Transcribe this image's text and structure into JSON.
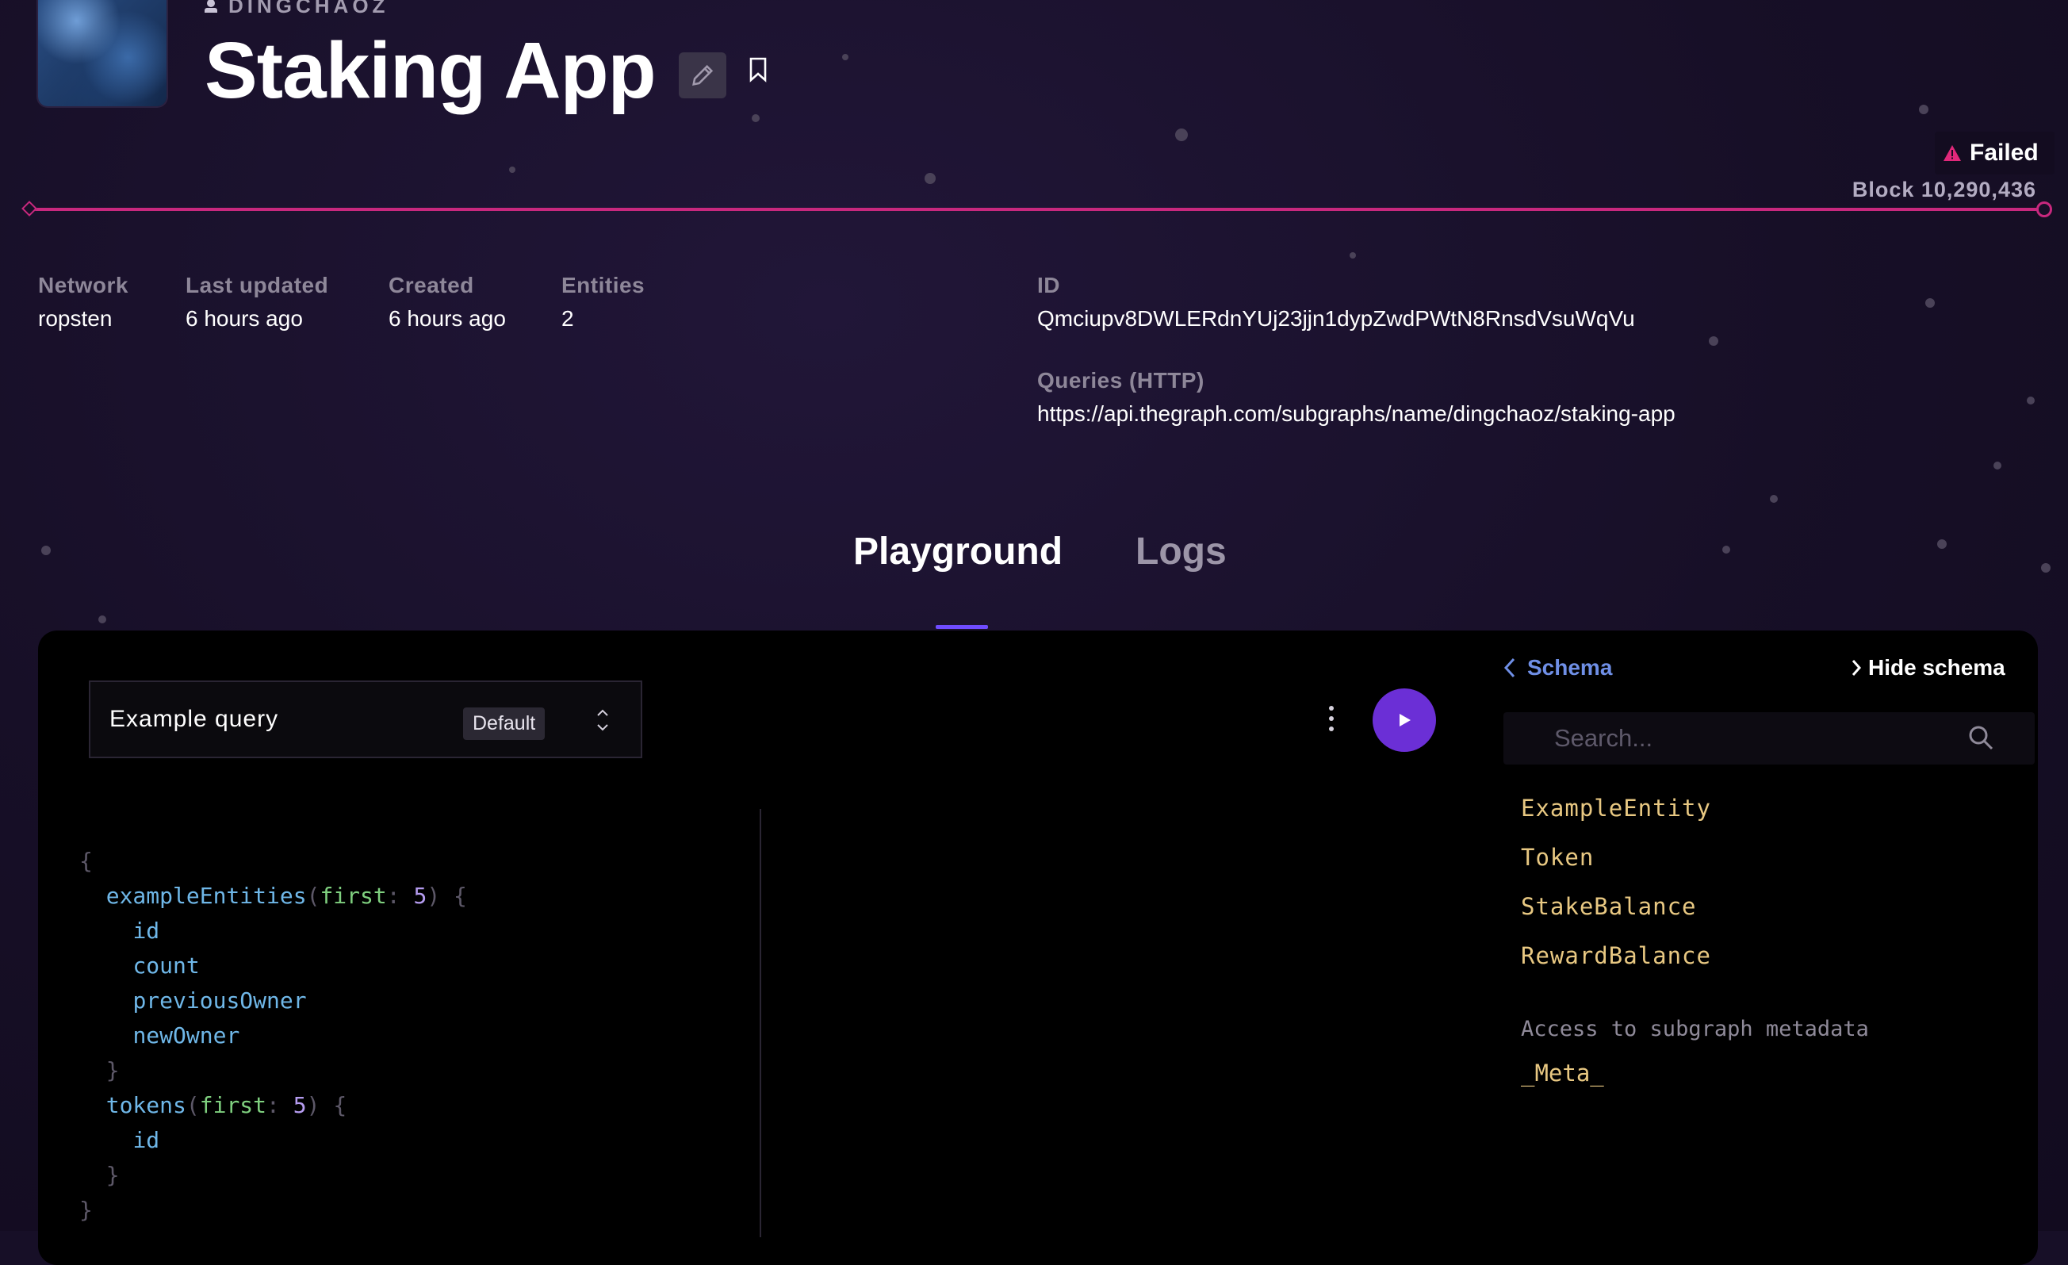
{
  "header": {
    "owner": "DINGCHAOZ",
    "title": "Staking App",
    "status": "Failed",
    "block": "Block 10,290,436"
  },
  "details": {
    "network_label": "Network",
    "network_value": "ropsten",
    "updated_label": "Last updated",
    "updated_value": "6 hours ago",
    "created_label": "Created",
    "created_value": "6 hours ago",
    "entities_label": "Entities",
    "entities_value": "2",
    "id_label": "ID",
    "id_value": "Qmciupv8DWLERdnYUj23jjn1dypZwdPWtN8RnsdVsuWqVu",
    "queries_label": "Queries (HTTP)",
    "queries_value": "https://api.thegraph.com/subgraphs/name/dingchaoz/staking-app"
  },
  "tabs": {
    "playground": "Playground",
    "logs": "Logs"
  },
  "playground": {
    "query_name": "Example query",
    "query_badge": "Default",
    "editor": {
      "entities_field": "exampleEntities",
      "first_arg": "first",
      "first_value": "5",
      "fields": [
        "id",
        "count",
        "previousOwner",
        "newOwner"
      ],
      "tokens_field": "tokens",
      "tokens_fields": [
        "id"
      ]
    }
  },
  "schema": {
    "back_label": "Schema",
    "hide_label": "Hide schema",
    "search_placeholder": "Search...",
    "types": [
      "ExampleEntity",
      "Token",
      "StakeBalance",
      "RewardBalance"
    ],
    "meta_note": "Access to subgraph metadata",
    "meta_type": "_Meta_"
  },
  "colors": {
    "accent_purple": "#6b2fd6",
    "progress_pink": "#c8287e",
    "failed_pink": "#e0287a"
  }
}
